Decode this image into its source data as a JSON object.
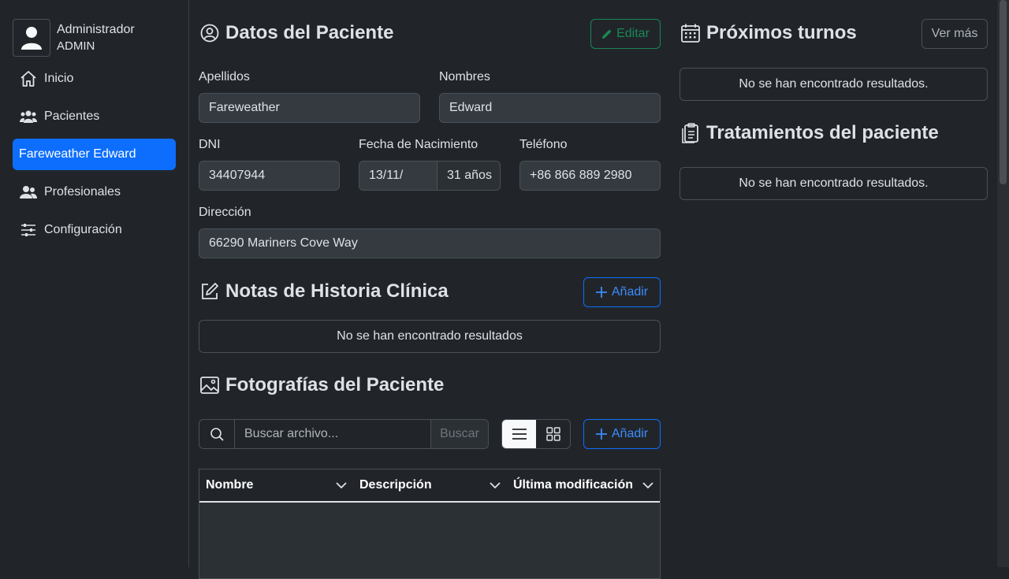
{
  "user": {
    "name": "Administrador",
    "role": "ADMIN"
  },
  "nav": [
    {
      "label": "Inicio",
      "icon": "home-icon"
    },
    {
      "label": "Pacientes",
      "icon": "users-icon"
    },
    {
      "label": "Fareweather Edward",
      "active": true
    },
    {
      "label": "Profesionales",
      "icon": "people-icon"
    },
    {
      "label": "Configuración",
      "icon": "sliders-icon"
    }
  ],
  "patient": {
    "heading": "Datos del Paciente",
    "edit_label": "Editar",
    "apellidos_label": "Apellidos",
    "apellidos": "Fareweather",
    "nombres_label": "Nombres",
    "nombres": "Edward",
    "dni_label": "DNI",
    "dni": "34407944",
    "birth_label": "Fecha de Nacimiento",
    "birth": "13/11/",
    "age": "31 años",
    "phone_label": "Teléfono",
    "phone": "+86 866 889 2980",
    "address_label": "Dirección",
    "address": "66290 Mariners Cove Way"
  },
  "notes": {
    "heading": "Notas de Historia Clínica",
    "add_label": "Añadir",
    "empty": "No se han encontrado resultados"
  },
  "photos": {
    "heading": "Fotografías del Paciente",
    "search_placeholder": "Buscar archivo...",
    "search_button": "Buscar",
    "add_label": "Añadir",
    "columns": [
      "Nombre",
      "Descripción",
      "Última modificación"
    ]
  },
  "appointments": {
    "heading": "Próximos turnos",
    "more_label": "Ver más",
    "empty": "No se han encontrado resultados."
  },
  "treatments": {
    "heading": "Tratamientos del paciente",
    "empty": "No se han encontrado resultados."
  },
  "colors": {
    "accent": "#0d6efd",
    "success": "#198754",
    "background": "#212529"
  }
}
